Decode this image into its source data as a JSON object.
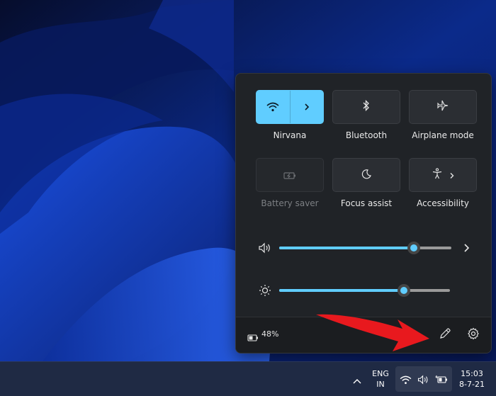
{
  "tiles": [
    {
      "label": "Nirvana",
      "icon": "wifi-icon",
      "state": "active"
    },
    {
      "label": "Bluetooth",
      "icon": "bluetooth-icon",
      "state": "off"
    },
    {
      "label": "Airplane mode",
      "icon": "airplane-icon",
      "state": "off"
    },
    {
      "label": "Battery saver",
      "icon": "battery-saver-icon",
      "state": "disabled"
    },
    {
      "label": "Focus assist",
      "icon": "moon-icon",
      "state": "off"
    },
    {
      "label": "Accessibility",
      "icon": "accessibility-icon",
      "state": "off"
    }
  ],
  "sliders": {
    "volume": {
      "icon": "volume-icon",
      "level": 0.78
    },
    "brightness": {
      "icon": "brightness-icon",
      "level": 0.73
    }
  },
  "footer": {
    "battery_text": "48%",
    "edit_icon": "pencil-icon",
    "settings_icon": "gear-icon"
  },
  "taskbar": {
    "language_line1": "ENG",
    "language_line2": "IN",
    "time": "15:03",
    "date": "8-7-21"
  },
  "colors": {
    "accent": "#60cdff",
    "panel": "#202327",
    "annotation_arrow": "#e8191e"
  }
}
